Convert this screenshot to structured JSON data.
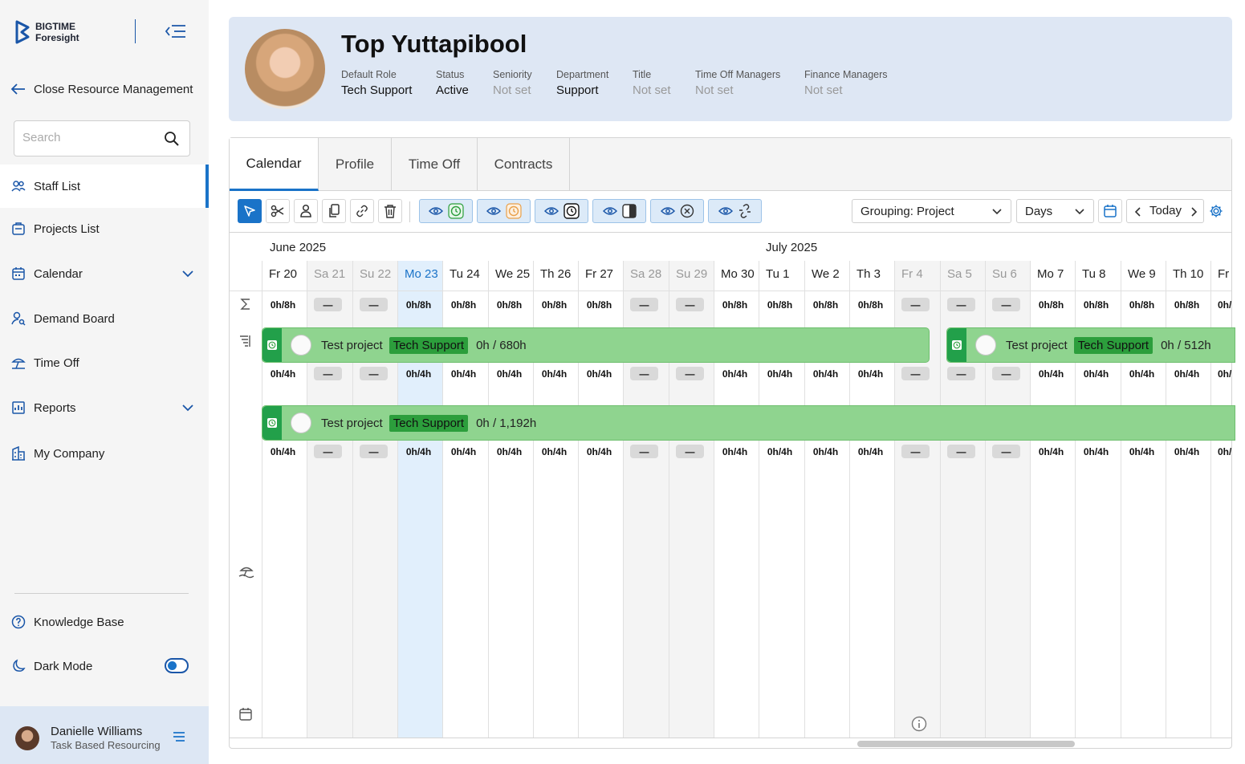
{
  "brand": {
    "line1": "BIGTIME",
    "line2": "Foresight"
  },
  "sidebar": {
    "close_label": "Close Resource Management",
    "search_placeholder": "Search",
    "items": [
      {
        "label": "Staff List"
      },
      {
        "label": "Projects List"
      },
      {
        "label": "Calendar"
      },
      {
        "label": "Demand Board"
      },
      {
        "label": "Time Off"
      },
      {
        "label": "Reports"
      },
      {
        "label": "My Company"
      }
    ],
    "knowledge_base": "Knowledge Base",
    "dark_mode": "Dark Mode",
    "user": {
      "name": "Danielle Williams",
      "role": "Task Based Resourcing"
    }
  },
  "staff": {
    "name": "Top Yuttapibool",
    "fields": [
      {
        "label": "Default Role",
        "value": "Tech Support"
      },
      {
        "label": "Status",
        "value": "Active"
      },
      {
        "label": "Seniority",
        "value": "Not set"
      },
      {
        "label": "Department",
        "value": "Support"
      },
      {
        "label": "Title",
        "value": "Not set"
      },
      {
        "label": "Time Off Managers",
        "value": "Not set"
      },
      {
        "label": "Finance Managers",
        "value": "Not set"
      }
    ]
  },
  "tabs": [
    {
      "label": "Calendar"
    },
    {
      "label": "Profile"
    },
    {
      "label": "Time Off"
    },
    {
      "label": "Contracts"
    }
  ],
  "toolbar": {
    "grouping": "Grouping: Project",
    "scale": "Days",
    "today": "Today"
  },
  "calendar": {
    "months": [
      {
        "label": "June 2025"
      },
      {
        "label": "July 2025"
      }
    ],
    "days": [
      "Fr 20",
      "Sa 21",
      "Su 22",
      "Mo 23",
      "Tu 24",
      "We 25",
      "Th 26",
      "Fr 27",
      "Sa 28",
      "Su 29",
      "Mo 30",
      "Tu 1",
      "We 2",
      "Th 3",
      "Fr 4",
      "Sa 5",
      "Su 6",
      "Mo 7",
      "Tu 8",
      "We 9",
      "Th 10",
      "Fr"
    ],
    "weekend_days": [
      1,
      2,
      8,
      9,
      15,
      16
    ],
    "nonworking_days": [
      14
    ],
    "today_index": 3,
    "summary_cells": [
      "0h/8h",
      "—",
      "—",
      "0h/8h",
      "0h/8h",
      "0h/8h",
      "0h/8h",
      "0h/8h",
      "—",
      "—",
      "0h/8h",
      "0h/8h",
      "0h/8h",
      "0h/8h",
      "—",
      "—",
      "—",
      "0h/8h",
      "0h/8h",
      "0h/8h",
      "0h/8h",
      "0h/"
    ],
    "row_cells": [
      "0h/4h",
      "—",
      "—",
      "0h/4h",
      "0h/4h",
      "0h/4h",
      "0h/4h",
      "0h/4h",
      "—",
      "—",
      "0h/4h",
      "0h/4h",
      "0h/4h",
      "0h/4h",
      "—",
      "—",
      "—",
      "0h/4h",
      "0h/4h",
      "0h/4h",
      "0h/4h",
      "0h/"
    ],
    "bars": [
      {
        "project": "Test project",
        "role": "Tech Support",
        "hours": "0h / 680h"
      },
      {
        "project": "Test project",
        "role": "Tech Support",
        "hours": "0h / 512h"
      },
      {
        "project": "Test project",
        "role": "Tech Support",
        "hours": "0h / 1,192h"
      }
    ]
  },
  "colors": {
    "accent": "#1a73c8",
    "bar": "#8fd48f",
    "bar_stripe": "#22a04a",
    "role_badge": "#2c9e3c",
    "header_bg": "#dee7f4"
  }
}
